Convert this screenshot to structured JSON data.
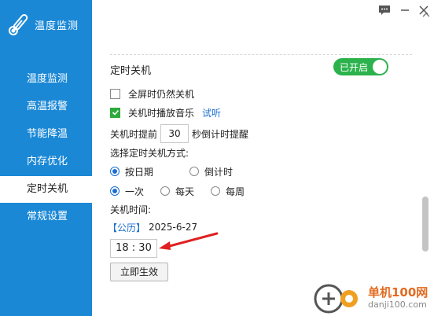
{
  "app": {
    "title": "温度监测",
    "icon": "thermometer-icon"
  },
  "window_controls": {
    "feedback_icon": "chat-icon",
    "minimize_icon": "minimize-icon",
    "close_icon": "close-icon"
  },
  "sidebar": {
    "items": [
      {
        "label": "温度监测",
        "active": false
      },
      {
        "label": "高温报警",
        "active": false
      },
      {
        "label": "节能降温",
        "active": false
      },
      {
        "label": "内存优化",
        "active": false
      },
      {
        "label": "定时关机",
        "active": true
      },
      {
        "label": "常规设置",
        "active": false
      }
    ]
  },
  "shutdown": {
    "title": "定时关机",
    "toggle_label": "已开启",
    "toggle_on": true,
    "fullscreen_label": "全屏时仍然关机",
    "fullscreen_checked": false,
    "music_label": "关机时播放音乐",
    "music_checked": true,
    "listen_link": "试听",
    "remind_prefix": "关机时提前",
    "remind_value": "30",
    "remind_suffix": "秒倒计时提醒",
    "mode_label": "选择定时关机方式:",
    "mode_options": [
      "按日期",
      "倒计时"
    ],
    "mode_selected": "按日期",
    "freq_options": [
      "一次",
      "每天",
      "每周"
    ],
    "freq_selected": "一次",
    "time_label": "关机时间:",
    "calendar_tag": "【公历】",
    "date": "2025-6-27",
    "time": "18 : 30",
    "apply_label": "立即生效"
  },
  "watermark": {
    "cn": "单机100网",
    "url": "danji100.com"
  },
  "colors": {
    "sidebar": "#1b88d6",
    "toggle": "#2bb24c",
    "link": "#1b6fd0",
    "arrow": "#e02020"
  }
}
